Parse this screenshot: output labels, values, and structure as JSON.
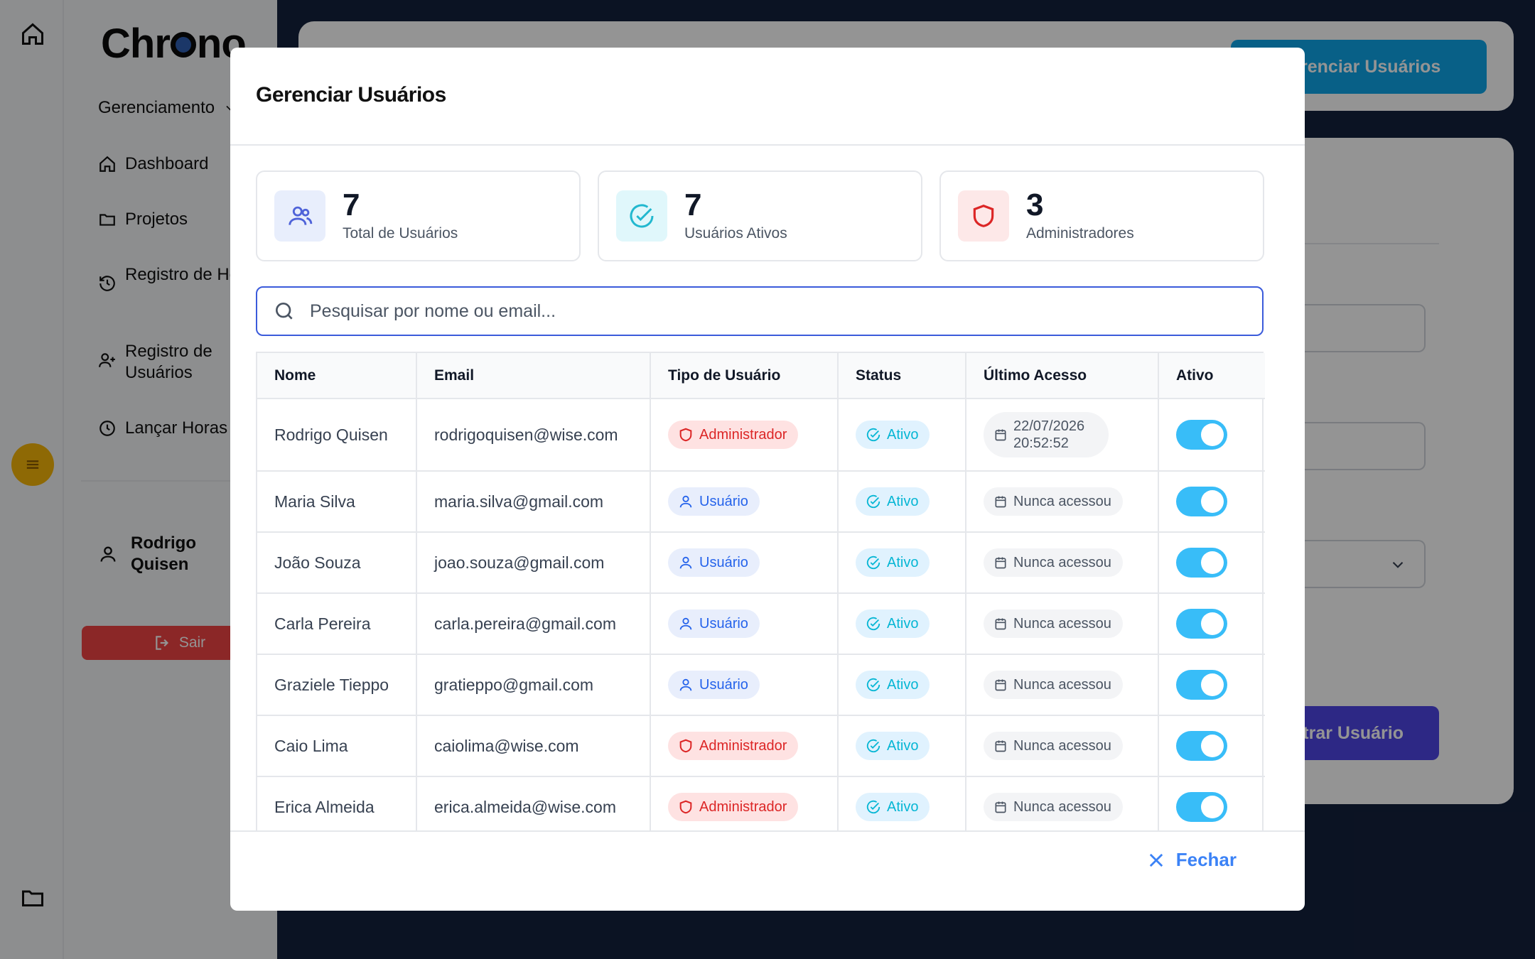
{
  "app": {
    "logo": "Chrono",
    "nav_group": "Gerenciamento",
    "nav": [
      "Dashboard",
      "Projetos",
      "Registro de Horas",
      "Registro de Usuários",
      "Lançar Horas"
    ],
    "user_name": "Rodrigo Quisen",
    "logout_label": "Sair",
    "top_button": "Gerenciar Usuários",
    "submit_button": "strar Usuário"
  },
  "modal": {
    "title": "Gerenciar Usuários",
    "stats": [
      {
        "value": "7",
        "label": "Total de Usuários",
        "icon": "users-icon"
      },
      {
        "value": "7",
        "label": "Usuários Ativos",
        "icon": "check-circle-icon"
      },
      {
        "value": "3",
        "label": "Administradores",
        "icon": "shield-icon"
      }
    ],
    "search_placeholder": "Pesquisar por nome ou email...",
    "columns": [
      "Nome",
      "Email",
      "Tipo de Usuário",
      "Status",
      "Último Acesso",
      "Ativo"
    ],
    "rows": [
      {
        "name": "Rodrigo Quisen",
        "email": "rodrigoquisen@wise.com",
        "type": "Administrador",
        "status": "Ativo",
        "last_access": "22/07/2026 20:52:52",
        "active": true
      },
      {
        "name": "Maria Silva",
        "email": "maria.silva@gmail.com",
        "type": "Usuário",
        "status": "Ativo",
        "last_access": "Nunca acessou",
        "active": true
      },
      {
        "name": "João Souza",
        "email": "joao.souza@gmail.com",
        "type": "Usuário",
        "status": "Ativo",
        "last_access": "Nunca acessou",
        "active": true
      },
      {
        "name": "Carla Pereira",
        "email": "carla.pereira@gmail.com",
        "type": "Usuário",
        "status": "Ativo",
        "last_access": "Nunca acessou",
        "active": true
      },
      {
        "name": "Graziele Tieppo",
        "email": "gratieppo@gmail.com",
        "type": "Usuário",
        "status": "Ativo",
        "last_access": "Nunca acessou",
        "active": true
      },
      {
        "name": "Caio Lima",
        "email": "caiolima@wise.com",
        "type": "Administrador",
        "status": "Ativo",
        "last_access": "Nunca acessou",
        "active": true
      },
      {
        "name": "Erica Almeida",
        "email": "erica.almeida@wise.com",
        "type": "Administrador",
        "status": "Ativo",
        "last_access": "Nunca acessou",
        "active": true
      }
    ],
    "close_label": "Fechar"
  },
  "colors": {
    "accent_blue": "#3b82f6",
    "admin_red": "#dc2626",
    "status_cyan": "#06b6d4",
    "toggle_on": "#38bdf8",
    "logo_accent": "#f5b50a"
  }
}
